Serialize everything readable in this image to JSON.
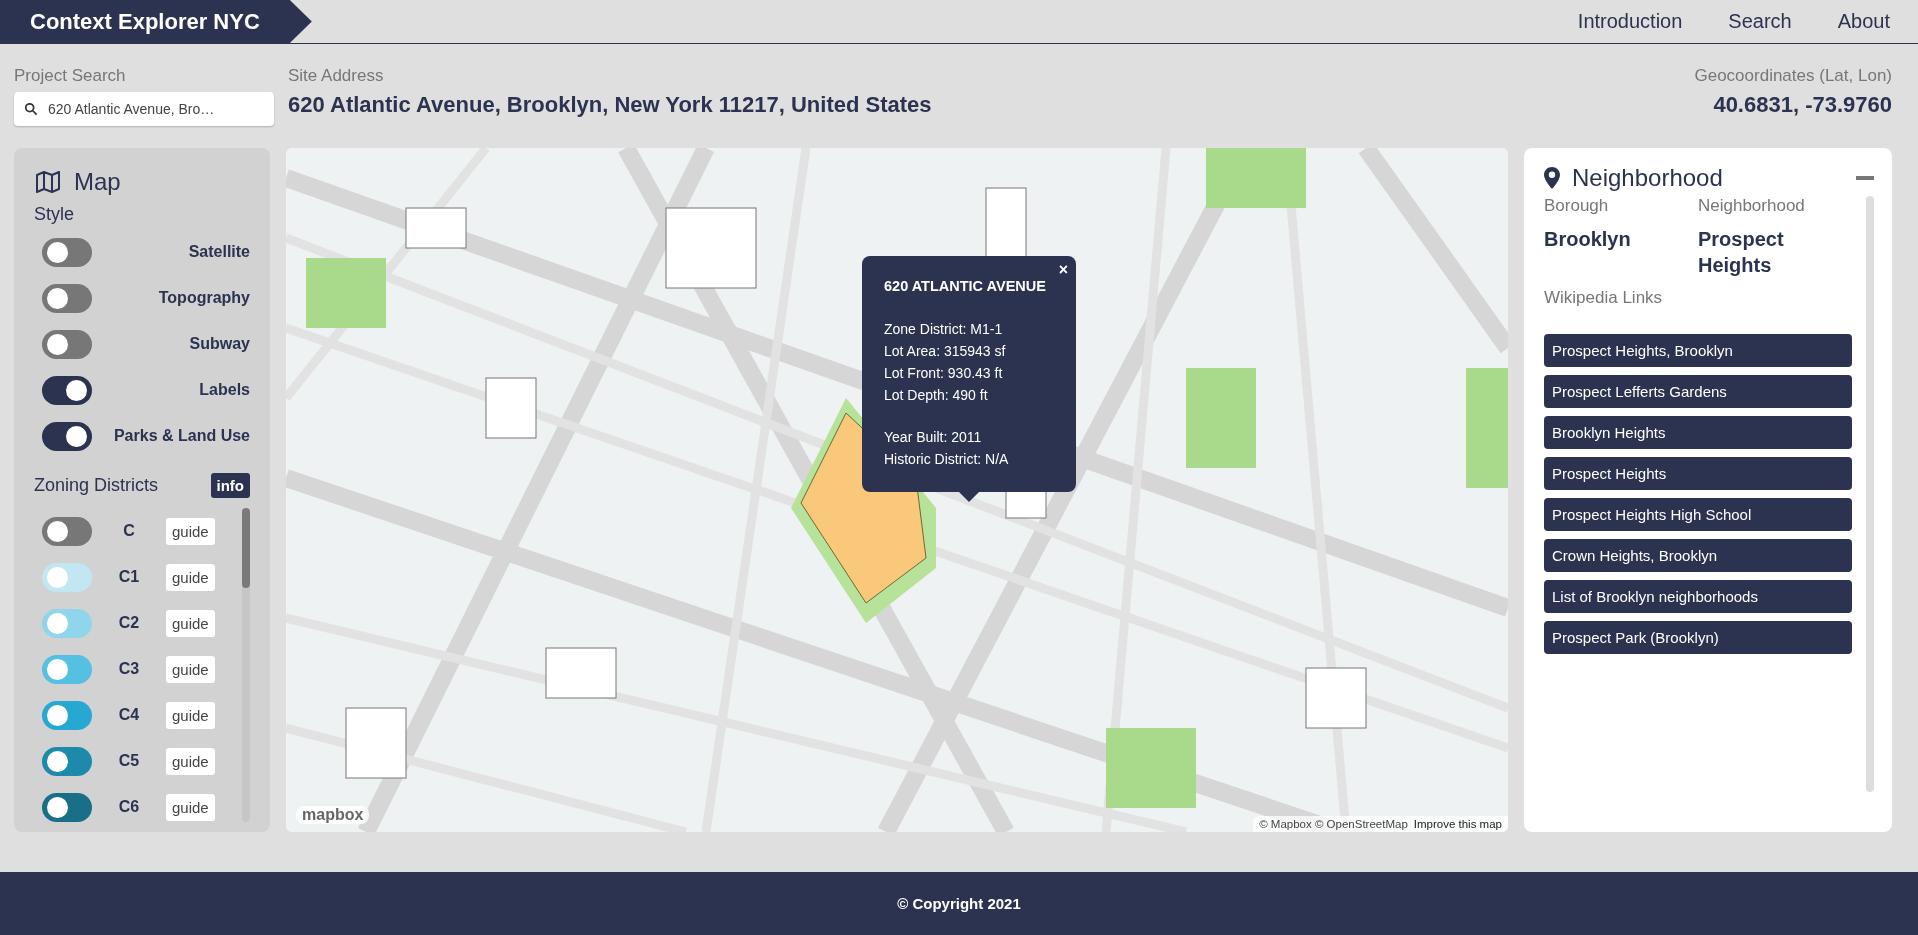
{
  "header": {
    "title": "Context Explorer NYC",
    "nav": [
      {
        "label": "Introduction"
      },
      {
        "label": "Search"
      },
      {
        "label": "About"
      }
    ]
  },
  "project_search": {
    "label": "Project Search",
    "value": "620 Atlantic Avenue, Bro…"
  },
  "site_address": {
    "label": "Site Address",
    "value": "620 Atlantic Avenue, Brooklyn, New York 11217, United States"
  },
  "geocoordinates": {
    "label": "Geocoordinates (Lat, Lon)",
    "value": "40.6831, -73.9760"
  },
  "map_panel": {
    "title": "Map",
    "style_label": "Style",
    "layers": [
      {
        "label": "Satellite",
        "on": false
      },
      {
        "label": "Topography",
        "on": false
      },
      {
        "label": "Subway",
        "on": false
      },
      {
        "label": "Labels",
        "on": true
      },
      {
        "label": "Parks & Land Use",
        "on": true
      }
    ],
    "zoning_title": "Zoning Districts",
    "info_button": "info",
    "districts": [
      {
        "label": "C",
        "on": false,
        "color": "#777777",
        "guide": "guide"
      },
      {
        "label": "C1",
        "on": false,
        "color": "#c2e7f3",
        "guide": "guide"
      },
      {
        "label": "C2",
        "on": false,
        "color": "#8fd6ec",
        "guide": "guide"
      },
      {
        "label": "C3",
        "on": false,
        "color": "#55c0e2",
        "guide": "guide"
      },
      {
        "label": "C4",
        "on": false,
        "color": "#27a8d3",
        "guide": "guide"
      },
      {
        "label": "C5",
        "on": false,
        "color": "#1e8aab",
        "guide": "guide"
      },
      {
        "label": "C6",
        "on": false,
        "color": "#196e88",
        "guide": "guide"
      }
    ]
  },
  "popup": {
    "title": "620 ATLANTIC AVENUE",
    "close": "×",
    "groups": [
      [
        "Zone District: M1-1",
        "Lot Area: 315943 sf",
        "Lot Front: 930.43 ft",
        "Lot Depth: 490 ft"
      ],
      [
        "Year Built: 2011",
        "Historic District: N/A"
      ]
    ]
  },
  "attribution": {
    "logo": "mapbox",
    "credits": "© Mapbox © OpenStreetMap",
    "link": "Improve this map"
  },
  "neighborhood": {
    "title": "Neighborhood",
    "borough_label": "Borough",
    "borough": "Brooklyn",
    "neighborhood_label": "Neighborhood",
    "neighborhood": "Prospect Heights",
    "links_label": "Wikipedia Links",
    "links": [
      "Prospect Heights, Brooklyn",
      "Prospect Lefferts Gardens",
      "Brooklyn Heights",
      "Prospect Heights",
      "Prospect Heights High School",
      "Crown Heights, Brooklyn",
      "List of Brooklyn neighborhoods",
      "Prospect Park (Brooklyn)"
    ]
  },
  "footer": {
    "text": "© Copyright 2021"
  }
}
